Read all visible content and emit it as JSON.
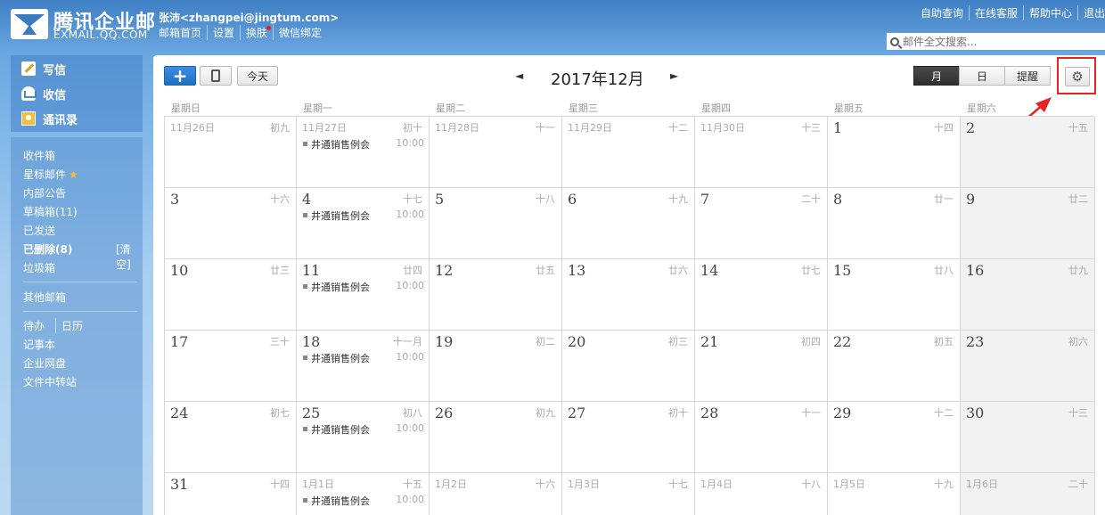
{
  "header": {
    "logo_cn": "腾讯企业邮",
    "logo_en": "EXMAIL.QQ.COM",
    "user_email": "张沛<zhangpei@jingtum.com>",
    "user_links": [
      "邮箱首页",
      "设置",
      "换肤",
      "微信绑定"
    ],
    "top_links": [
      "自助查询",
      "在线客服",
      "帮助中心",
      "退出"
    ],
    "search_placeholder": "邮件全文搜索..."
  },
  "sidebar": {
    "compose": [
      "写信",
      "收信",
      "通讯录"
    ],
    "folders": {
      "inbox": "收件箱",
      "starred": "星标邮件",
      "announce": "内部公告",
      "drafts": "草稿箱(11)",
      "sent": "已发送",
      "deleted": "已删除(8)",
      "clear": "[清空]",
      "spam": "垃圾箱",
      "other": "其他邮箱",
      "todo": "待办",
      "calendar": "日历",
      "notes": "记事本",
      "disk": "企业网盘",
      "transfer": "文件中转站"
    }
  },
  "toolbar": {
    "add_label": "+",
    "today_label": "今天",
    "prev": "◄",
    "next": "►",
    "month_title": "2017年12月",
    "views": [
      "月",
      "日",
      "提醒"
    ],
    "active_view": "月"
  },
  "weekdays": [
    "星期日",
    "星期一",
    "星期二",
    "星期三",
    "星期四",
    "星期五",
    "星期六"
  ],
  "weeks": [
    [
      {
        "d": "11月26日",
        "l": "初九",
        "o": true
      },
      {
        "d": "11月27日",
        "l": "初十",
        "o": true,
        "e": true
      },
      {
        "d": "11月28日",
        "l": "十一",
        "o": true
      },
      {
        "d": "11月29日",
        "l": "十二",
        "o": true
      },
      {
        "d": "11月30日",
        "l": "十三",
        "o": true
      },
      {
        "d": "1",
        "l": "十四"
      },
      {
        "d": "2",
        "l": "十五"
      }
    ],
    [
      {
        "d": "3",
        "l": "十六"
      },
      {
        "d": "4",
        "l": "十七",
        "e": true
      },
      {
        "d": "5",
        "l": "十八"
      },
      {
        "d": "6",
        "l": "十九"
      },
      {
        "d": "7",
        "l": "二十"
      },
      {
        "d": "8",
        "l": "廿一"
      },
      {
        "d": "9",
        "l": "廿二"
      }
    ],
    [
      {
        "d": "10",
        "l": "廿三"
      },
      {
        "d": "11",
        "l": "廿四",
        "e": true
      },
      {
        "d": "12",
        "l": "廿五"
      },
      {
        "d": "13",
        "l": "廿六"
      },
      {
        "d": "14",
        "l": "廿七"
      },
      {
        "d": "15",
        "l": "廿八"
      },
      {
        "d": "16",
        "l": "廿九"
      }
    ],
    [
      {
        "d": "17",
        "l": "三十"
      },
      {
        "d": "18",
        "l": "十一月",
        "e": true
      },
      {
        "d": "19",
        "l": "初二"
      },
      {
        "d": "20",
        "l": "初三"
      },
      {
        "d": "21",
        "l": "初四"
      },
      {
        "d": "22",
        "l": "初五"
      },
      {
        "d": "23",
        "l": "初六"
      }
    ],
    [
      {
        "d": "24",
        "l": "初七"
      },
      {
        "d": "25",
        "l": "初八",
        "e": true
      },
      {
        "d": "26",
        "l": "初九"
      },
      {
        "d": "27",
        "l": "初十"
      },
      {
        "d": "28",
        "l": "十一"
      },
      {
        "d": "29",
        "l": "十二"
      },
      {
        "d": "30",
        "l": "十三"
      }
    ],
    [
      {
        "d": "31",
        "l": "十四"
      },
      {
        "d": "1月1日",
        "l": "十五",
        "o": true,
        "e": true
      },
      {
        "d": "1月2日",
        "l": "十六",
        "o": true
      },
      {
        "d": "1月3日",
        "l": "十七",
        "o": true
      },
      {
        "d": "1月4日",
        "l": "十八",
        "o": true
      },
      {
        "d": "1月5日",
        "l": "十九",
        "o": true
      },
      {
        "d": "1月6日",
        "l": "二十",
        "o": true
      }
    ]
  ],
  "event": {
    "title": "井通销售例会",
    "time": "10:00"
  },
  "colors": {
    "accent": "#1f6fc2",
    "highlight": "#e62222",
    "weekend_bg": "#f2f2f2"
  }
}
